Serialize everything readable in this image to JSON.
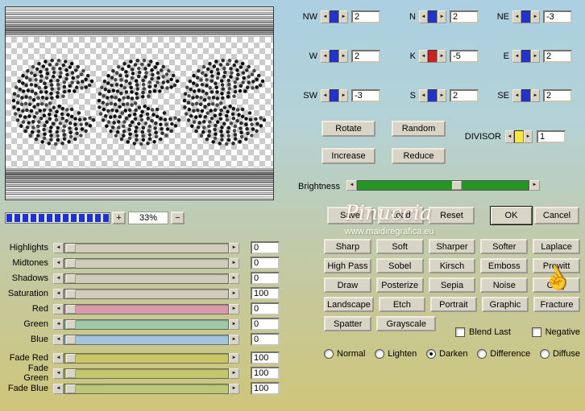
{
  "icons": {
    "arrow_left": "◄",
    "arrow_right": "►",
    "hand_cursor": "☝"
  },
  "preview": {
    "zoom_in_label": "+",
    "zoom_level": "33%",
    "zoom_out_label": "−"
  },
  "kernel": {
    "cells": [
      {
        "label": "NW",
        "value": "2",
        "accent": "#2233cc"
      },
      {
        "label": "N",
        "value": "2",
        "accent": "#2233cc"
      },
      {
        "label": "NE",
        "value": "-3",
        "accent": "#2233cc"
      },
      {
        "label": "W",
        "value": "2",
        "accent": "#2233cc"
      },
      {
        "label": "K",
        "value": "-5",
        "accent": "#cc2222"
      },
      {
        "label": "E",
        "value": "2",
        "accent": "#2233cc"
      },
      {
        "label": "SW",
        "value": "-3",
        "accent": "#2233cc"
      },
      {
        "label": "S",
        "value": "2",
        "accent": "#2233cc"
      },
      {
        "label": "SE",
        "value": "2",
        "accent": "#2233cc"
      }
    ]
  },
  "divisor": {
    "label": "DIVISOR",
    "value": "1",
    "accent": "#f5e93c"
  },
  "transform_buttons": {
    "rotate": "Rotate",
    "random": "Random",
    "increase": "Increase",
    "reduce": "Reduce"
  },
  "brightness": {
    "label": "Brightness",
    "track_color": "#259625",
    "thumb_percent": 55
  },
  "action_buttons": {
    "save": "Save",
    "load": "Load",
    "reset": "Reset",
    "ok": "OK",
    "cancel": "Cancel"
  },
  "watermark": {
    "name": "Pinuccia",
    "site": "www.maidiregrafica.eu"
  },
  "filter_buttons": [
    [
      "Sharp",
      "Soft",
      "Sharper",
      "Softer",
      "Laplace"
    ],
    [
      "High Pass",
      "Sobel",
      "Kirsch",
      "Emboss",
      "Prewitt"
    ],
    [
      "Draw",
      "Posterize",
      "Sepia",
      "Noise",
      "Gray"
    ],
    [
      "Landscape",
      "Etch",
      "Portrait",
      "Graphic",
      "Fracture"
    ],
    [
      "Spatter",
      "Grayscale"
    ]
  ],
  "checkboxes": [
    {
      "label": "Blend Last",
      "checked": false
    },
    {
      "label": "Negative",
      "checked": false
    }
  ],
  "blend_modes": [
    {
      "label": "Normal",
      "selected": false
    },
    {
      "label": "Lighten",
      "selected": false
    },
    {
      "label": "Darken",
      "selected": true
    },
    {
      "label": "Difference",
      "selected": false
    },
    {
      "label": "Diffuse",
      "selected": false
    }
  ],
  "sliders": [
    {
      "label": "Highlights",
      "value": "0",
      "track": "#cfcdba",
      "thumb_percent": 1
    },
    {
      "label": "Midtones",
      "value": "0",
      "track": "#cfcdba",
      "thumb_percent": 1
    },
    {
      "label": "Shadows",
      "value": "0",
      "track": "#cfcdba",
      "thumb_percent": 1
    },
    {
      "label": "Saturation",
      "value": "100",
      "track": "#cfcdba",
      "thumb_percent": 1
    },
    {
      "label": "Red",
      "value": "0",
      "track": "#d79cab",
      "thumb_percent": 1
    },
    {
      "label": "Green",
      "value": "0",
      "track": "#9fc9a9",
      "thumb_percent": 1
    },
    {
      "label": "Blue",
      "value": "0",
      "track": "#a5c4de",
      "thumb_percent": 1
    },
    {
      "label": "Fade Red",
      "value": "100",
      "track": "#c9c765",
      "thumb_percent": 1
    },
    {
      "label": "Fade Green",
      "value": "100",
      "track": "#c2c76c",
      "thumb_percent": 1
    },
    {
      "label": "Fade Blue",
      "value": "100",
      "track": "#bdc778",
      "thumb_percent": 1
    }
  ]
}
